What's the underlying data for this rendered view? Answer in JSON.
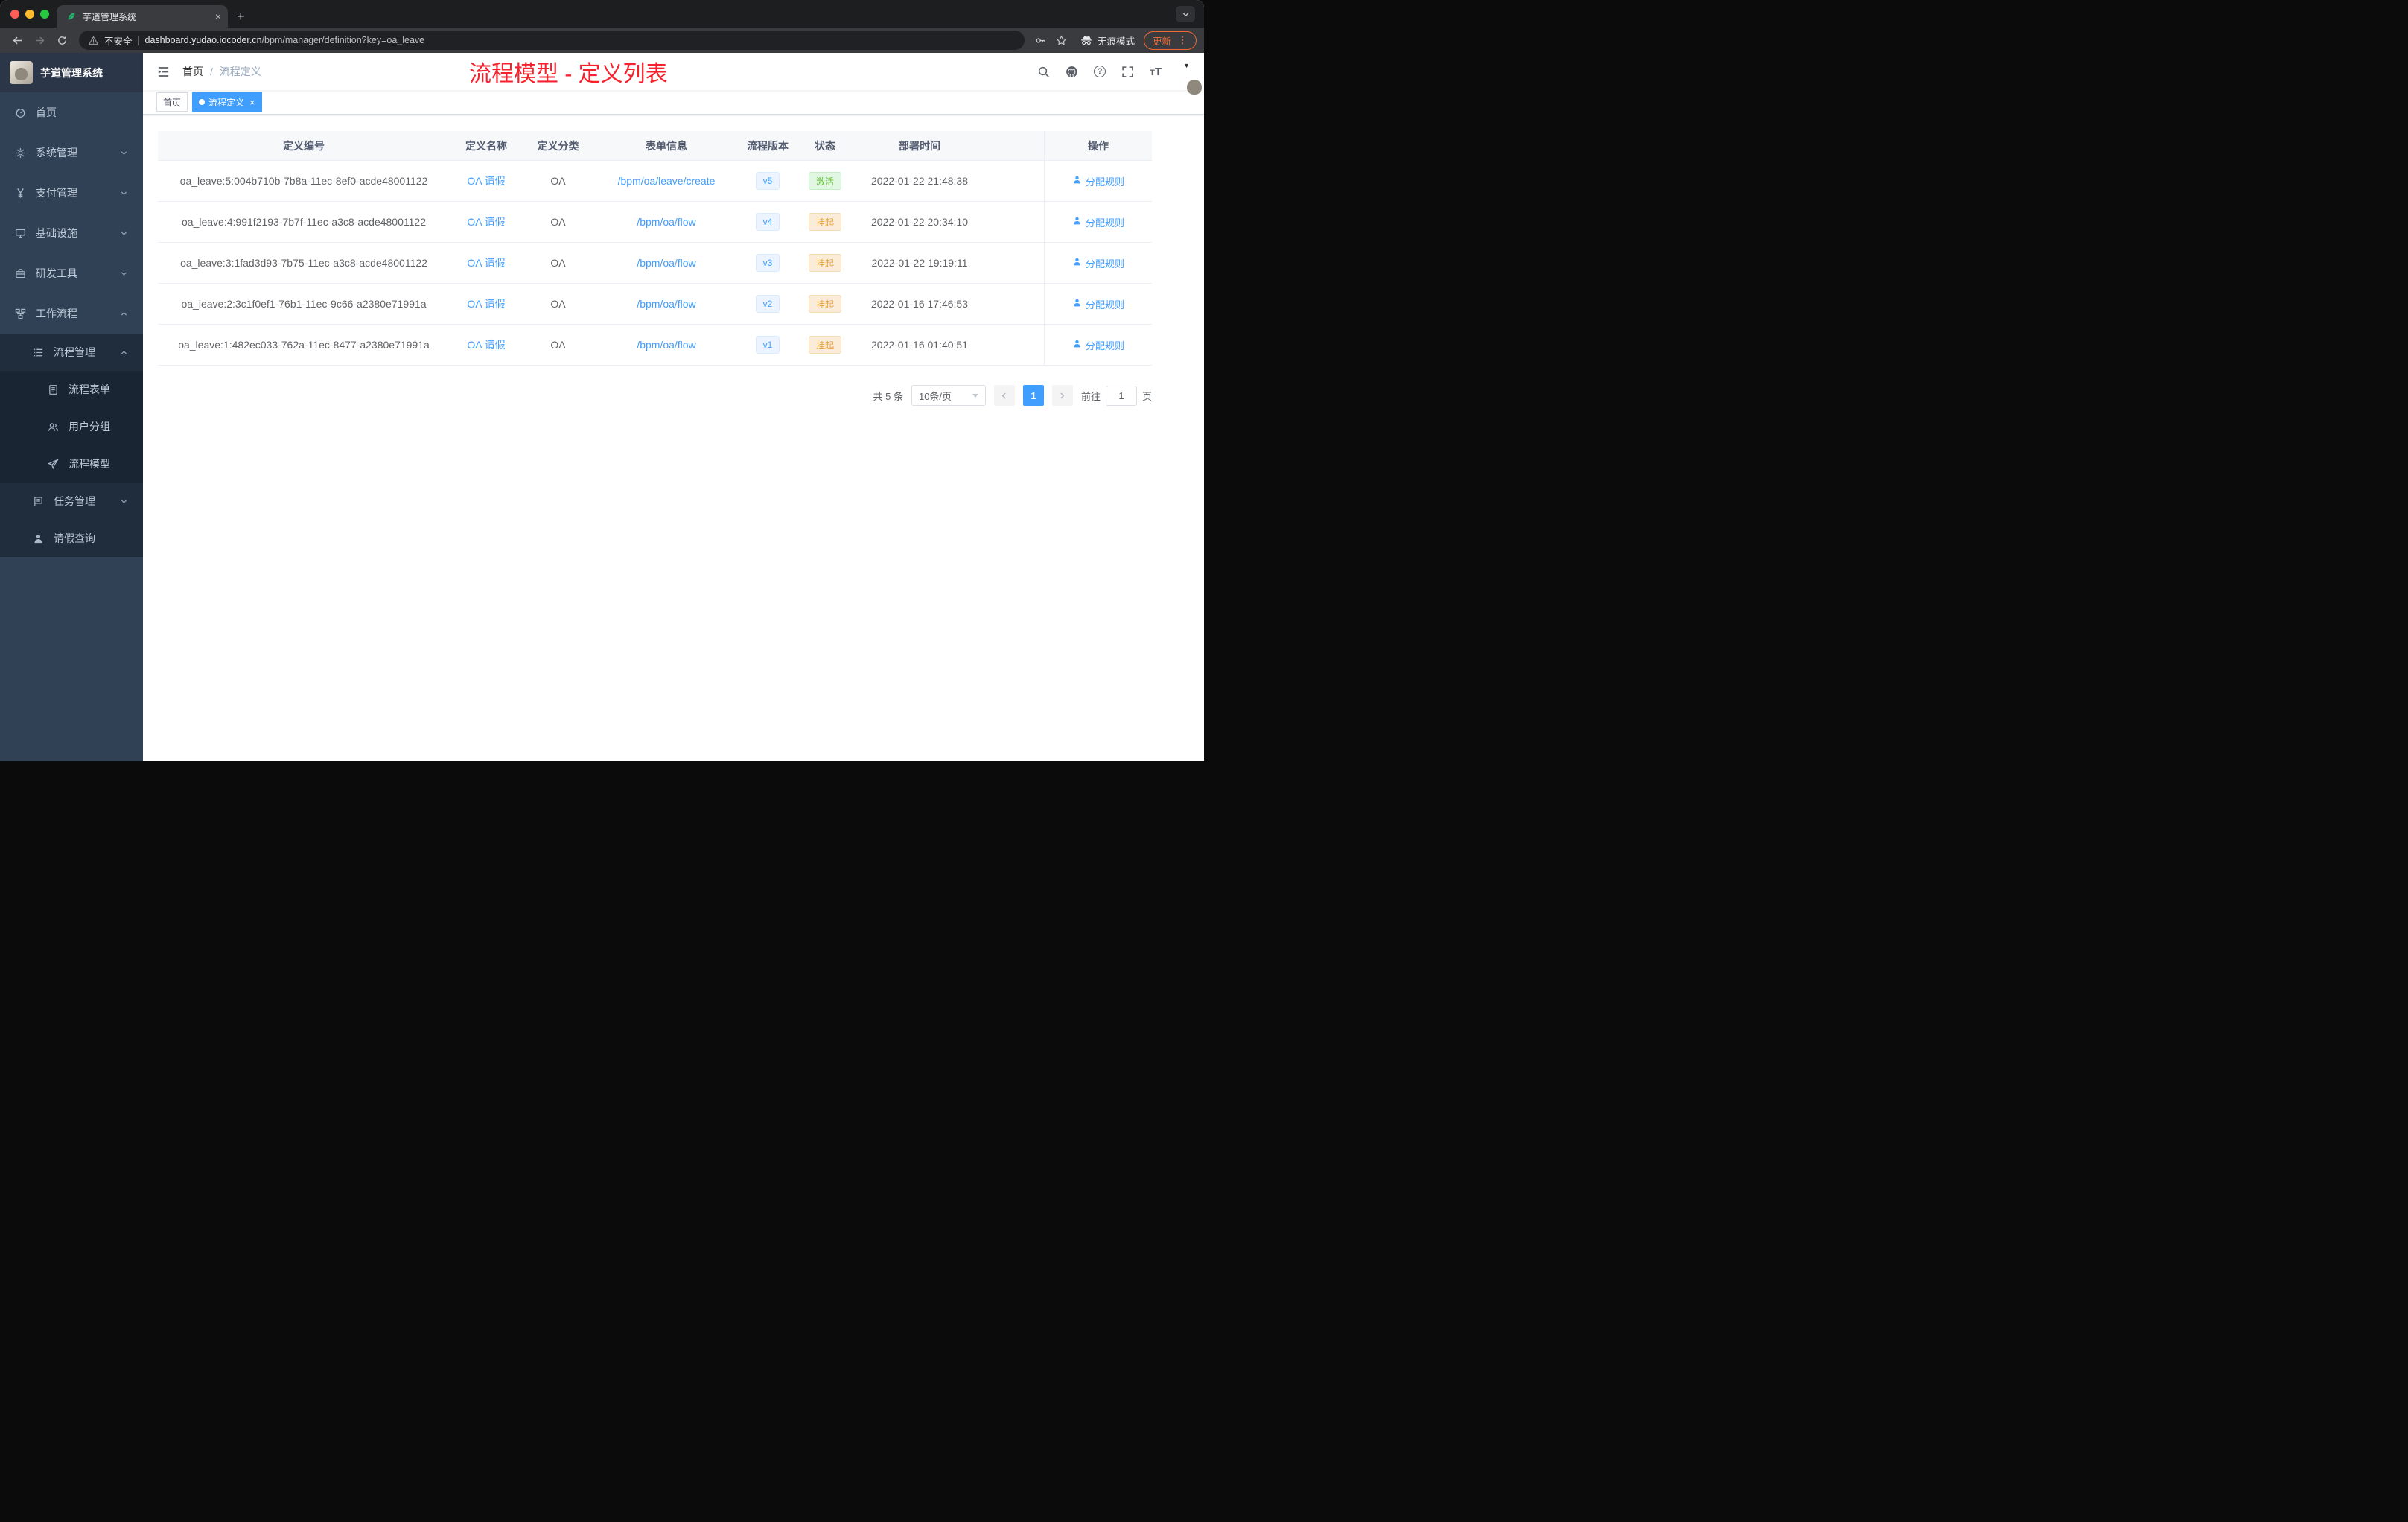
{
  "browser": {
    "tab_title": "芋道管理系统",
    "security_label": "不安全",
    "url_host": "dashboard.yudao.iocoder.cn",
    "url_path": "/bpm/manager/definition?key=oa_leave",
    "incognito_label": "无痕模式",
    "update_label": "更新"
  },
  "sidebar": {
    "title": "芋道管理系统",
    "menu": [
      {
        "key": "home",
        "label": "首页",
        "icon": "dashboard-icon",
        "level": 1,
        "chevron": null
      },
      {
        "key": "system",
        "label": "系统管理",
        "icon": "gear-icon",
        "level": 1,
        "chevron": "down"
      },
      {
        "key": "payment",
        "label": "支付管理",
        "icon": "yen-icon",
        "level": 1,
        "chevron": "down"
      },
      {
        "key": "infra",
        "label": "基础设施",
        "icon": "monitor-icon",
        "level": 1,
        "chevron": "down"
      },
      {
        "key": "devtools",
        "label": "研发工具",
        "icon": "toolbox-icon",
        "level": 1,
        "chevron": "down"
      },
      {
        "key": "workflow",
        "label": "工作流程",
        "icon": "workflow-icon",
        "level": 1,
        "chevron": "up"
      },
      {
        "key": "process-manage",
        "label": "流程管理",
        "icon": "list-icon",
        "level": 2,
        "chevron": "up"
      },
      {
        "key": "process-form",
        "label": "流程表单",
        "icon": "form-icon",
        "level": 3,
        "chevron": null
      },
      {
        "key": "user-group",
        "label": "用户分组",
        "icon": "users-icon",
        "level": 3,
        "chevron": null
      },
      {
        "key": "process-model",
        "label": "流程模型",
        "icon": "send-icon",
        "level": 3,
        "chevron": null
      },
      {
        "key": "task-manage",
        "label": "任务管理",
        "icon": "task-icon",
        "level": 2,
        "chevron": "down"
      },
      {
        "key": "leave-query",
        "label": "请假查询",
        "icon": "user-icon",
        "level": 2,
        "chevron": null
      }
    ]
  },
  "navbar": {
    "breadcrumb_home": "首页",
    "breadcrumb_separator": "/",
    "breadcrumb_current": "流程定义",
    "annotation": "流程模型 - 定义列表"
  },
  "tags": [
    {
      "key": "home",
      "label": "首页",
      "active": false,
      "closable": false
    },
    {
      "key": "process-definition",
      "label": "流程定义",
      "active": true,
      "closable": true
    }
  ],
  "table": {
    "headers": [
      "定义编号",
      "定义名称",
      "定义分类",
      "表单信息",
      "流程版本",
      "状态",
      "部署时间",
      "操作"
    ],
    "rows": [
      {
        "id": "oa_leave:5:004b710b-7b8a-11ec-8ef0-acde48001122",
        "name": "OA 请假",
        "category": "OA",
        "form": "/bpm/oa/leave/create",
        "version": "v5",
        "status": "激活",
        "status_type": "success",
        "deployed_at": "2022-01-22 21:48:38",
        "action": "分配规则"
      },
      {
        "id": "oa_leave:4:991f2193-7b7f-11ec-a3c8-acde48001122",
        "name": "OA 请假",
        "category": "OA",
        "form": "/bpm/oa/flow",
        "version": "v4",
        "status": "挂起",
        "status_type": "warning",
        "deployed_at": "2022-01-22 20:34:10",
        "action": "分配规则"
      },
      {
        "id": "oa_leave:3:1fad3d93-7b75-11ec-a3c8-acde48001122",
        "name": "OA 请假",
        "category": "OA",
        "form": "/bpm/oa/flow",
        "version": "v3",
        "status": "挂起",
        "status_type": "warning",
        "deployed_at": "2022-01-22 19:19:11",
        "action": "分配规则"
      },
      {
        "id": "oa_leave:2:3c1f0ef1-76b1-11ec-9c66-a2380e71991a",
        "name": "OA 请假",
        "category": "OA",
        "form": "/bpm/oa/flow",
        "version": "v2",
        "status": "挂起",
        "status_type": "warning",
        "deployed_at": "2022-01-16 17:46:53",
        "action": "分配规则"
      },
      {
        "id": "oa_leave:1:482ec033-762a-11ec-8477-a2380e71991a",
        "name": "OA 请假",
        "category": "OA",
        "form": "/bpm/oa/flow",
        "version": "v1",
        "status": "挂起",
        "status_type": "warning",
        "deployed_at": "2022-01-16 01:40:51",
        "action": "分配规则"
      }
    ]
  },
  "pagination": {
    "total_label": "共 5 条",
    "page_size_label": "10条/页",
    "pages": [
      "1"
    ],
    "current_page": "1",
    "goto_label": "前往",
    "goto_value": "1",
    "unit_label": "页"
  },
  "colors": {
    "accent": "#409eff",
    "success": "#67c23a",
    "warning": "#e6a23c",
    "annotation": "#f5222d",
    "sidebar_bg": "#304156",
    "submenu_bg": "#1f2d3d"
  }
}
